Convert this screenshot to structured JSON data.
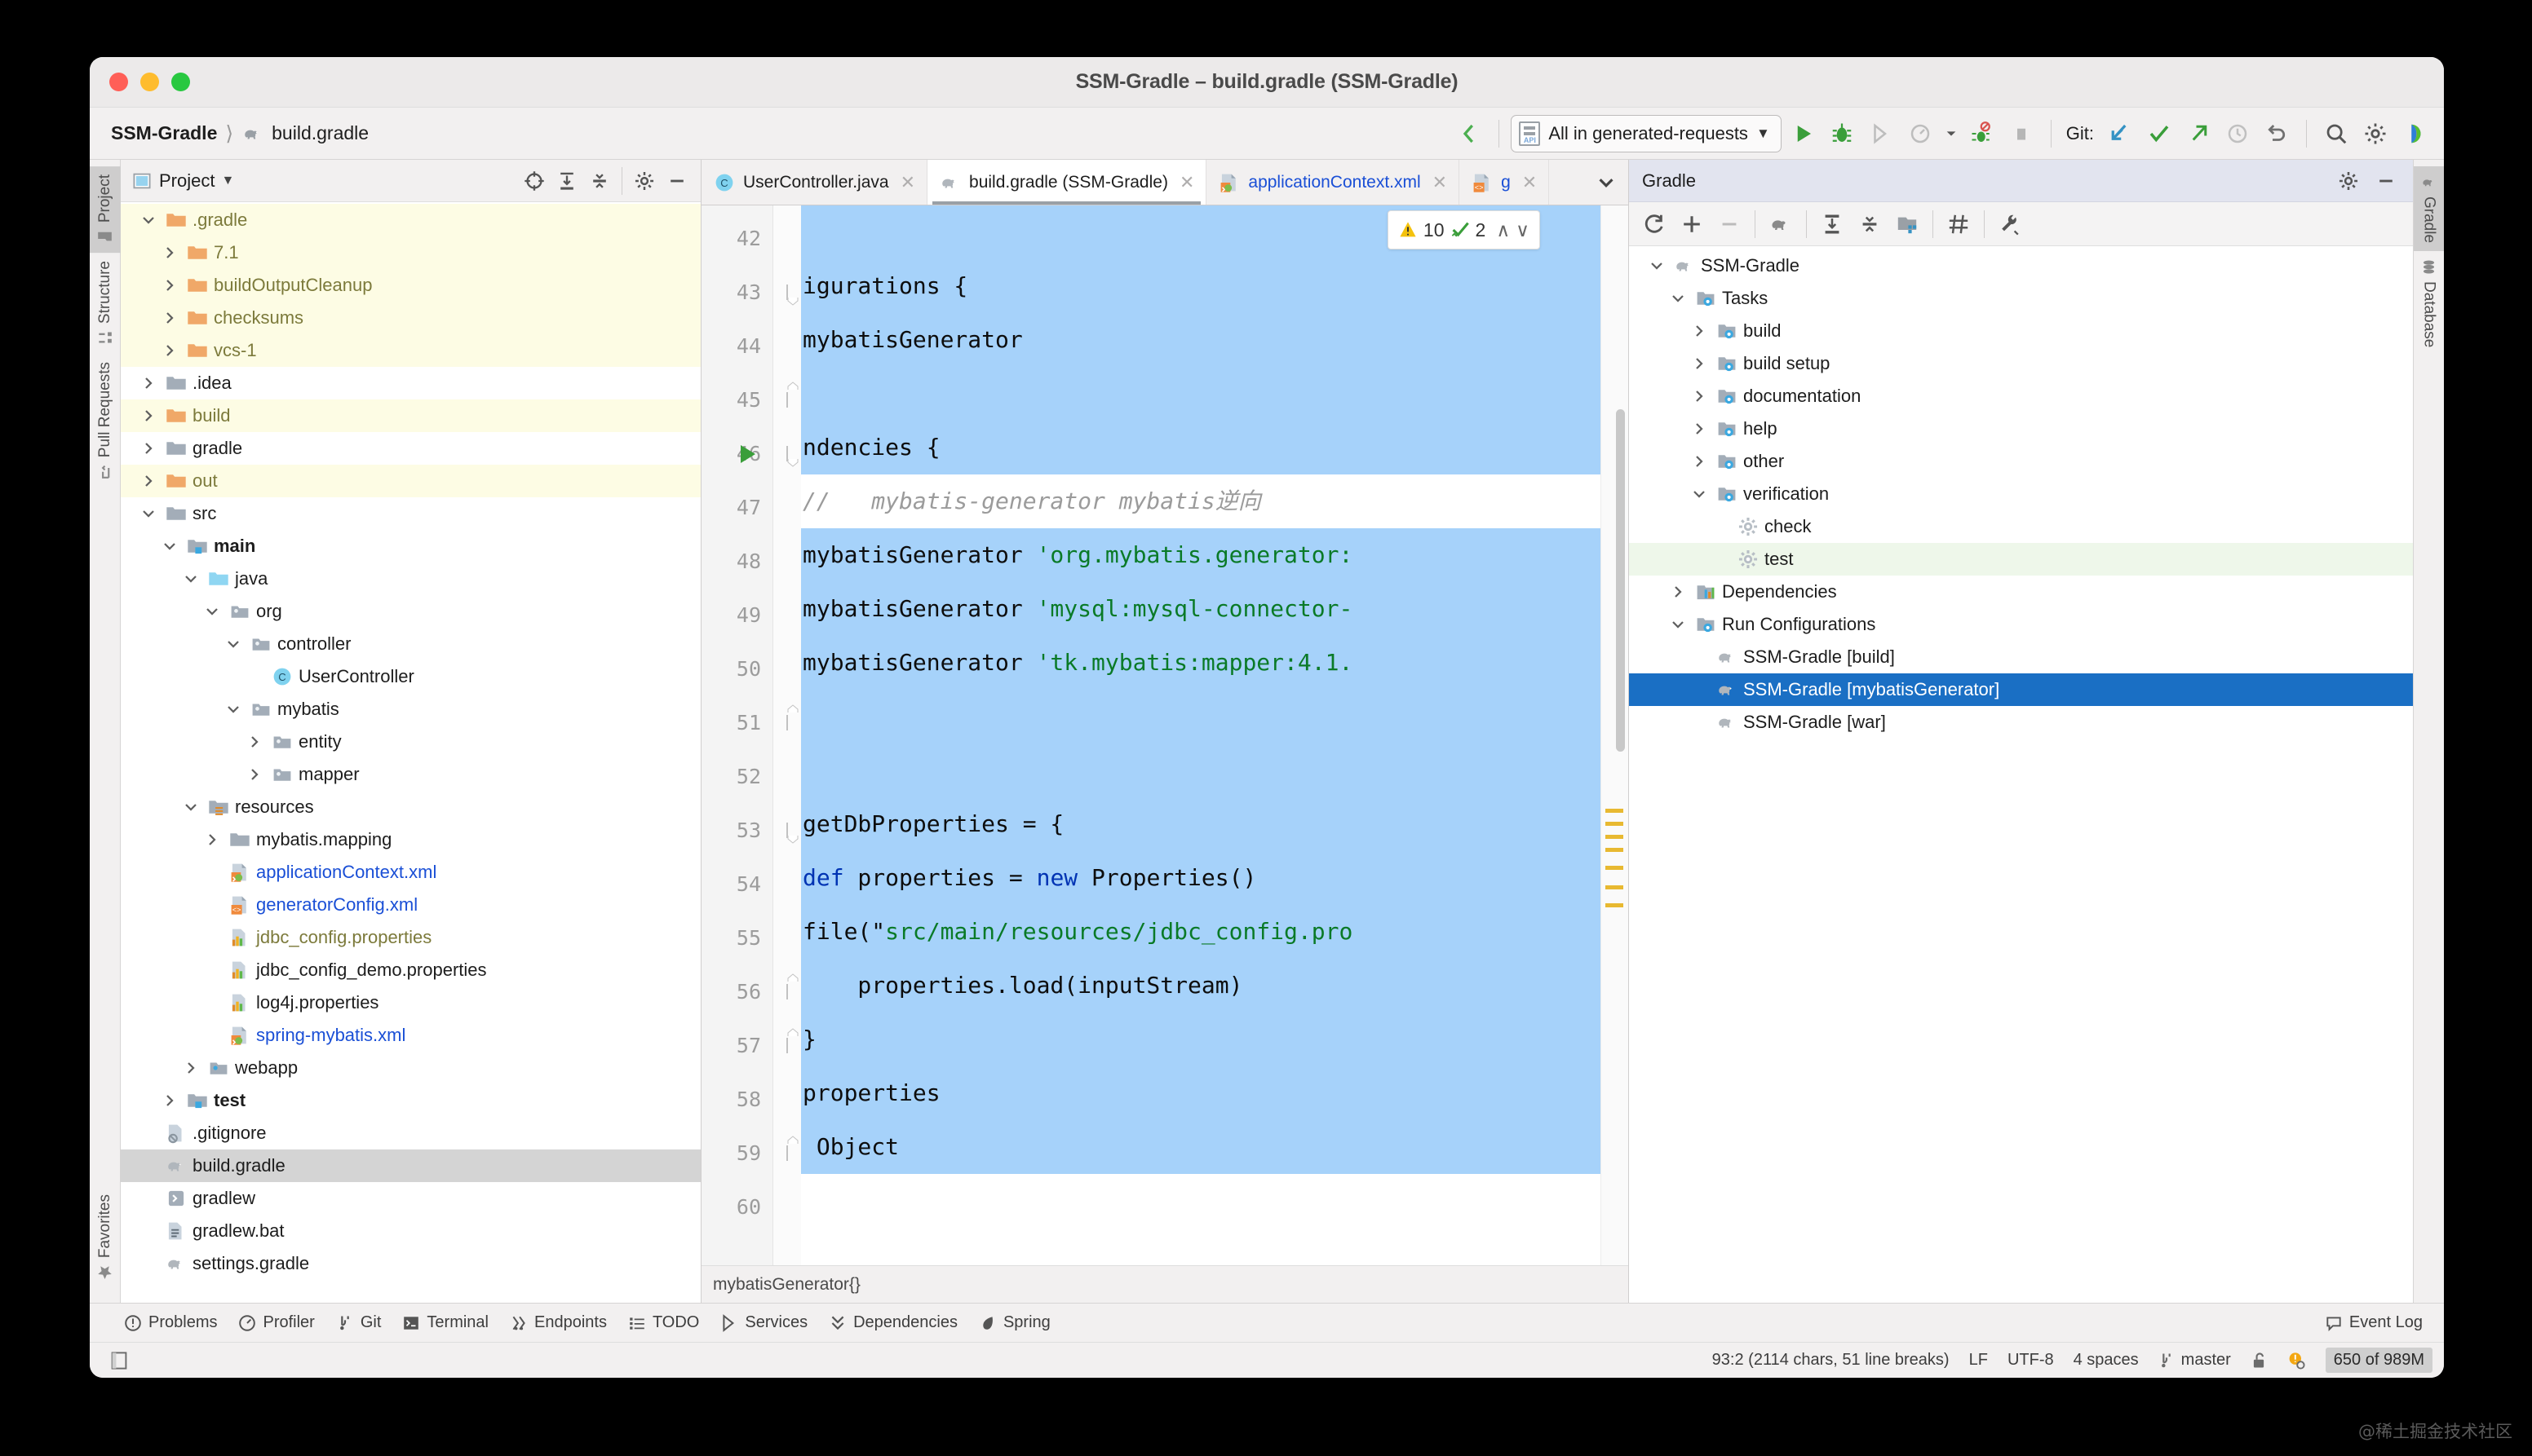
{
  "window": {
    "title": "SSM-Gradle – build.gradle (SSM-Gradle)"
  },
  "navbar": {
    "breadcrumb": [
      {
        "label": "SSM-Gradle",
        "icon": "none"
      },
      {
        "label": "build.gradle",
        "icon": "gradle-elephant-icon"
      }
    ],
    "run_config": {
      "label": "All in generated-requests",
      "icon": "api-file-icon",
      "chevron": "▼"
    },
    "git_label": "Git:",
    "buttons": [
      "back-arrow-button",
      "run-button",
      "debug-button",
      "run-with-coverage-button",
      "profile-button",
      "profile-dropdown",
      "stop-debug-button",
      "stop-button",
      "git-update-button",
      "git-commit-button",
      "git-push-button",
      "git-history-button",
      "git-rollback-button",
      "search-everywhere-button",
      "settings-button",
      "ide-assistant-button"
    ]
  },
  "left_rail": {
    "items": [
      {
        "label": "Project",
        "icon": "project-icon",
        "active": true
      },
      {
        "label": "Structure",
        "icon": "structure-icon",
        "active": false
      },
      {
        "label": "Pull Requests",
        "icon": "pull-requests-icon",
        "active": false
      }
    ],
    "bottom": [
      {
        "label": "Favorites",
        "icon": "star-icon",
        "active": false
      }
    ]
  },
  "right_rail": {
    "items": [
      {
        "label": "Gradle",
        "icon": "gradle-elephant-icon",
        "active": true
      },
      {
        "label": "Database",
        "icon": "database-icon",
        "active": false
      }
    ]
  },
  "project_panel": {
    "title": "Project",
    "dropdown": "▼",
    "toolbar_buttons": [
      "select-opened-file-icon",
      "expand-all-icon",
      "collapse-all-icon",
      "gear-icon",
      "hide-icon"
    ],
    "tree": [
      {
        "label": ".gradle",
        "depth": 1,
        "state": "expanded",
        "icon": "folder-orange-icon",
        "style": "excluded"
      },
      {
        "label": "7.1",
        "depth": 2,
        "state": "collapsed",
        "icon": "folder-orange-icon",
        "style": "excluded"
      },
      {
        "label": "buildOutputCleanup",
        "depth": 2,
        "state": "collapsed",
        "icon": "folder-orange-icon",
        "style": "excluded"
      },
      {
        "label": "checksums",
        "depth": 2,
        "state": "collapsed",
        "icon": "folder-orange-icon",
        "style": "excluded"
      },
      {
        "label": "vcs-1",
        "depth": 2,
        "state": "collapsed",
        "icon": "folder-orange-icon",
        "style": "excluded"
      },
      {
        "label": ".idea",
        "depth": 1,
        "state": "collapsed",
        "icon": "folder-gray-icon",
        "style": "normal"
      },
      {
        "label": "build",
        "depth": 1,
        "state": "collapsed",
        "icon": "folder-orange-icon",
        "style": "excluded"
      },
      {
        "label": "gradle",
        "depth": 1,
        "state": "collapsed",
        "icon": "folder-gray-icon",
        "style": "normal"
      },
      {
        "label": "out",
        "depth": 1,
        "state": "collapsed",
        "icon": "folder-orange-icon",
        "style": "excluded"
      },
      {
        "label": "src",
        "depth": 1,
        "state": "expanded",
        "icon": "folder-gray-icon",
        "style": "normal"
      },
      {
        "label": "main",
        "depth": 2,
        "state": "expanded",
        "icon": "folder-module-icon",
        "style": "bold"
      },
      {
        "label": "java",
        "depth": 3,
        "state": "expanded",
        "icon": "folder-source-icon",
        "style": "normal"
      },
      {
        "label": "org",
        "depth": 4,
        "state": "expanded",
        "icon": "package-icon",
        "style": "normal"
      },
      {
        "label": "controller",
        "depth": 5,
        "state": "expanded",
        "icon": "package-icon",
        "style": "normal"
      },
      {
        "label": "UserController",
        "depth": 6,
        "state": "leaf",
        "icon": "class-icon",
        "style": "normal"
      },
      {
        "label": "mybatis",
        "depth": 5,
        "state": "expanded",
        "icon": "package-icon",
        "style": "normal"
      },
      {
        "label": "entity",
        "depth": 6,
        "state": "collapsed",
        "icon": "package-icon",
        "style": "normal"
      },
      {
        "label": "mapper",
        "depth": 6,
        "state": "collapsed",
        "icon": "package-icon",
        "style": "normal"
      },
      {
        "label": "resources",
        "depth": 3,
        "state": "expanded",
        "icon": "folder-resource-icon",
        "style": "normal"
      },
      {
        "label": "mybatis.mapping",
        "depth": 4,
        "state": "collapsed",
        "icon": "folder-gray-icon",
        "style": "normal"
      },
      {
        "label": "applicationContext.xml",
        "depth": 4,
        "state": "leaf",
        "icon": "spring-xml-icon",
        "style": "blue"
      },
      {
        "label": "generatorConfig.xml",
        "depth": 4,
        "state": "leaf",
        "icon": "xml-icon",
        "style": "blue"
      },
      {
        "label": "jdbc_config.properties",
        "depth": 4,
        "state": "leaf",
        "icon": "properties-icon",
        "style": "olive"
      },
      {
        "label": "jdbc_config_demo.properties",
        "depth": 4,
        "state": "leaf",
        "icon": "properties-icon",
        "style": "normal"
      },
      {
        "label": "log4j.properties",
        "depth": 4,
        "state": "leaf",
        "icon": "properties-icon",
        "style": "normal"
      },
      {
        "label": "spring-mybatis.xml",
        "depth": 4,
        "state": "leaf",
        "icon": "spring-xml-icon",
        "style": "blue"
      },
      {
        "label": "webapp",
        "depth": 3,
        "state": "collapsed",
        "icon": "webapp-icon",
        "style": "normal"
      },
      {
        "label": "test",
        "depth": 2,
        "state": "collapsed",
        "icon": "folder-module-icon",
        "style": "bold"
      },
      {
        "label": ".gitignore",
        "depth": 1,
        "state": "leaf",
        "icon": "gitignore-icon",
        "style": "normal"
      },
      {
        "label": "build.gradle",
        "depth": 1,
        "state": "leaf",
        "icon": "gradle-elephant-icon",
        "style": "selected"
      },
      {
        "label": "gradlew",
        "depth": 1,
        "state": "leaf",
        "icon": "shell-icon",
        "style": "normal"
      },
      {
        "label": "gradlew.bat",
        "depth": 1,
        "state": "leaf",
        "icon": "bat-icon",
        "style": "normal"
      },
      {
        "label": "settings.gradle",
        "depth": 1,
        "state": "leaf",
        "icon": "gradle-elephant-icon",
        "style": "normal"
      }
    ]
  },
  "editor": {
    "tabs": [
      {
        "label": "UserController.java",
        "icon": "class-icon",
        "active": false,
        "blue": false
      },
      {
        "label": "build.gradle (SSM-Gradle)",
        "icon": "gradle-elephant-icon",
        "active": true,
        "blue": false
      },
      {
        "label": "applicationContext.xml",
        "icon": "spring-xml-icon",
        "active": false,
        "blue": true
      },
      {
        "label": "g",
        "icon": "xml-icon",
        "active": false,
        "blue": true
      }
    ],
    "tabs_more_icon": "chevron-down-icon",
    "inspection_widget": {
      "warning_icon": "warning-triangle-icon",
      "warning_count": "10",
      "ok_icon": "check-green-icon",
      "ok_count": "2",
      "up_icon": "∧",
      "down_icon": "∨"
    },
    "first_line_number": 42,
    "lines": [
      {
        "n": 42,
        "text": "",
        "selected": true,
        "fold": "none",
        "run": false
      },
      {
        "n": 43,
        "text": "igurations {",
        "selected": true,
        "fold": "minus-top",
        "run": false,
        "tokens": [
          {
            "t": "igurations {",
            "k": "plain"
          }
        ]
      },
      {
        "n": 44,
        "text": "mybatisGenerator",
        "selected": true,
        "fold": "none",
        "run": false,
        "tokens": [
          {
            "t": "mybatisGenerator",
            "k": "plain"
          }
        ]
      },
      {
        "n": 45,
        "text": "",
        "selected": true,
        "fold": "minus-bottom",
        "run": false
      },
      {
        "n": 46,
        "text": "ndencies {",
        "selected": true,
        "fold": "minus-top",
        "run": true,
        "tokens": [
          {
            "t": "ndencies {",
            "k": "plain"
          }
        ]
      },
      {
        "n": 47,
        "text": "//   mybatis-generator mybatis逆向",
        "selected": false,
        "fold": "none",
        "run": false,
        "tokens": [
          {
            "t": "//   mybatis-generator mybatis逆向",
            "k": "cmt"
          }
        ]
      },
      {
        "n": 48,
        "text": "mybatisGenerator 'org.mybatis.generator:",
        "selected": true,
        "fold": "none",
        "run": false,
        "tokens": [
          {
            "t": "mybatisGenerator ",
            "k": "plain"
          },
          {
            "t": "'org.mybatis.generator:",
            "k": "str"
          }
        ]
      },
      {
        "n": 49,
        "text": "mybatisGenerator 'mysql:mysql-connector-",
        "selected": true,
        "fold": "none",
        "run": false,
        "tokens": [
          {
            "t": "mybatisGenerator ",
            "k": "plain"
          },
          {
            "t": "'mysql:mysql-connector-",
            "k": "str"
          }
        ]
      },
      {
        "n": 50,
        "text": "mybatisGenerator 'tk.mybatis:mapper:4.1.",
        "selected": true,
        "fold": "none",
        "run": false,
        "tokens": [
          {
            "t": "mybatisGenerator ",
            "k": "plain"
          },
          {
            "t": "'tk.mybatis:mapper:4.1.",
            "k": "str"
          }
        ]
      },
      {
        "n": 51,
        "text": "",
        "selected": true,
        "fold": "minus-bottom",
        "run": false
      },
      {
        "n": 52,
        "text": "",
        "selected": true,
        "fold": "none",
        "run": false
      },
      {
        "n": 53,
        "text": "getDbProperties = {",
        "selected": true,
        "fold": "minus-top",
        "run": false,
        "tokens": [
          {
            "t": "getDbProperties = {",
            "k": "plain"
          }
        ]
      },
      {
        "n": 54,
        "text": "def properties = new Properties()",
        "selected": true,
        "fold": "none",
        "run": false,
        "tokens": [
          {
            "t": "def",
            "k": "kw"
          },
          {
            "t": " properties = ",
            "k": "plain"
          },
          {
            "t": "new",
            "k": "kw"
          },
          {
            "t": " Properties()",
            "k": "plain"
          }
        ]
      },
      {
        "n": 55,
        "text": "file(\"src/main/resources/jdbc_config.pro",
        "selected": true,
        "fold": "none",
        "run": false,
        "tokens": [
          {
            "t": "file(\"",
            "k": "plain"
          },
          {
            "t": "src/main/resources/jdbc_config.pro",
            "k": "str"
          }
        ]
      },
      {
        "n": 56,
        "text": "    properties.load(inputStream)",
        "selected": true,
        "fold": "minus-bottom",
        "run": false,
        "tokens": [
          {
            "t": "    properties.load(inputStream)",
            "k": "plain"
          }
        ]
      },
      {
        "n": 57,
        "text": "}",
        "selected": true,
        "fold": "minus-end",
        "run": false,
        "tokens": [
          {
            "t": "}",
            "k": "plain"
          }
        ]
      },
      {
        "n": 58,
        "text": "properties",
        "selected": true,
        "fold": "none",
        "run": false,
        "tokens": [
          {
            "t": "properties",
            "k": "plain"
          }
        ]
      },
      {
        "n": 59,
        "text": " Object",
        "selected": true,
        "fold": "minus-end",
        "run": false,
        "tokens": [
          {
            "t": " Object",
            "k": "plain"
          }
        ]
      },
      {
        "n": 60,
        "text": "",
        "selected": false,
        "fold": "none",
        "run": false
      }
    ],
    "breadcrumb": "mybatisGenerator{}"
  },
  "gradle_panel": {
    "title": "Gradle",
    "head_buttons": [
      "gear-icon",
      "hide-icon"
    ],
    "toolbar_buttons": [
      "refresh-icon",
      "add-icon",
      "remove-icon",
      "execute-gradle-task-icon",
      "expand-all-icon",
      "collapse-all-icon",
      "tasks-grouping-icon",
      "toggle-offline-icon",
      "build-tool-settings-icon"
    ],
    "tree": [
      {
        "label": "SSM-Gradle",
        "depth": 1,
        "state": "expanded",
        "icon": "gradle-elephant-icon",
        "style": "normal"
      },
      {
        "label": "Tasks",
        "depth": 2,
        "state": "expanded",
        "icon": "tasks-folder-icon",
        "style": "normal"
      },
      {
        "label": "build",
        "depth": 3,
        "state": "collapsed",
        "icon": "tasks-folder-icon",
        "style": "normal"
      },
      {
        "label": "build setup",
        "depth": 3,
        "state": "collapsed",
        "icon": "tasks-folder-icon",
        "style": "normal"
      },
      {
        "label": "documentation",
        "depth": 3,
        "state": "collapsed",
        "icon": "tasks-folder-icon",
        "style": "normal"
      },
      {
        "label": "help",
        "depth": 3,
        "state": "collapsed",
        "icon": "tasks-folder-icon",
        "style": "normal"
      },
      {
        "label": "other",
        "depth": 3,
        "state": "collapsed",
        "icon": "tasks-folder-icon",
        "style": "normal"
      },
      {
        "label": "verification",
        "depth": 3,
        "state": "expanded",
        "icon": "tasks-folder-icon",
        "style": "normal"
      },
      {
        "label": "check",
        "depth": 4,
        "state": "leaf",
        "icon": "gear-task-icon",
        "style": "normal"
      },
      {
        "label": "test",
        "depth": 4,
        "state": "leaf",
        "icon": "gear-task-icon",
        "style": "greenish"
      },
      {
        "label": "Dependencies",
        "depth": 2,
        "state": "collapsed",
        "icon": "dependencies-icon",
        "style": "normal"
      },
      {
        "label": "Run Configurations",
        "depth": 2,
        "state": "expanded",
        "icon": "tasks-folder-icon",
        "style": "normal"
      },
      {
        "label": "SSM-Gradle [build]",
        "depth": 3,
        "state": "leaf",
        "icon": "gradle-elephant-icon",
        "style": "normal"
      },
      {
        "label": "SSM-Gradle [mybatisGenerator]",
        "depth": 3,
        "state": "leaf",
        "icon": "gradle-elephant-icon",
        "style": "selected-blue"
      },
      {
        "label": "SSM-Gradle [war]",
        "depth": 3,
        "state": "leaf",
        "icon": "gradle-elephant-icon",
        "style": "normal"
      }
    ]
  },
  "bottom_toolwindows": [
    {
      "label": "Problems",
      "icon": "problems-icon"
    },
    {
      "label": "Profiler",
      "icon": "profiler-icon"
    },
    {
      "label": "Git",
      "icon": "git-icon"
    },
    {
      "label": "Terminal",
      "icon": "terminal-icon"
    },
    {
      "label": "Endpoints",
      "icon": "endpoints-icon"
    },
    {
      "label": "TODO",
      "icon": "todo-icon"
    },
    {
      "label": "Services",
      "icon": "services-icon"
    },
    {
      "label": "Dependencies",
      "icon": "dependencies-tw-icon"
    },
    {
      "label": "Spring",
      "icon": "spring-icon"
    }
  ],
  "event_log": {
    "label": "Event Log",
    "icon": "event-log-icon"
  },
  "statusbar": {
    "left_icon": "layout-icon",
    "caret_info": "93:2 (2114 chars, 51 line breaks)",
    "line_separator": "LF",
    "encoding": "UTF-8",
    "indent": "4 spaces",
    "branch": "master",
    "branch_icon": "git-branch-icon",
    "lock_icon": "unlocked-icon",
    "inspection_icon": "inspection-warning-icon",
    "memory": "650 of 989M"
  },
  "watermark": "@稀土掘金技术社区",
  "colors": {
    "selection_blue": "#a6d2fa",
    "tree_selected_blue": "#1a6fc4",
    "excluded_yellow": "#fdfce4",
    "greenish_row": "#eef7ea",
    "string_green": "#0a7a27",
    "keyword_blue": "#0033b3",
    "comment_gray": "#9b9b9b"
  }
}
